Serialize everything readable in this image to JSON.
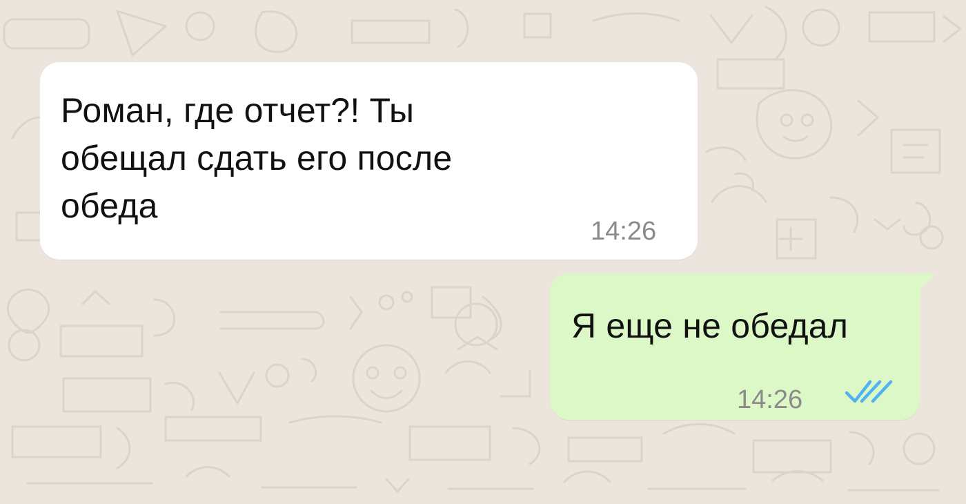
{
  "chat": {
    "messages": [
      {
        "direction": "incoming",
        "text": "Роман, где отчет?! Ты\nобещал сдать его после\nобеда",
        "time": "14:26"
      },
      {
        "direction": "outgoing",
        "text": "Я еще не обедал",
        "time": "14:26",
        "status_icon": "double-check-icon"
      }
    ]
  },
  "colors": {
    "background": "#ece5dd",
    "incoming_bubble": "#ffffff",
    "outgoing_bubble": "#dcf8c6",
    "timestamp": "#8b8b8b",
    "read_check": "#4fb3f2"
  }
}
